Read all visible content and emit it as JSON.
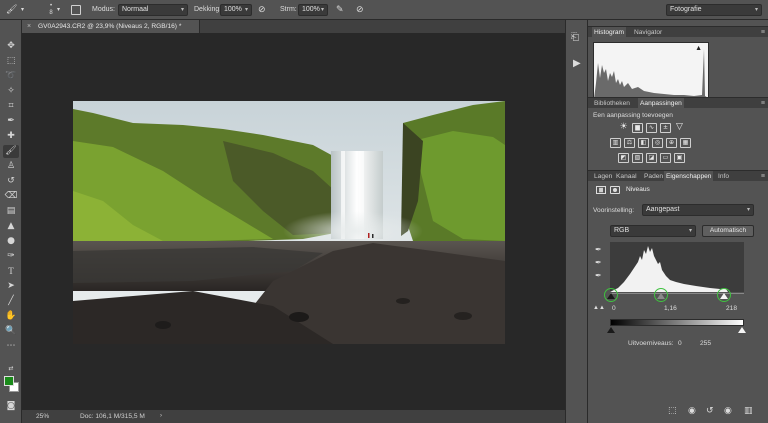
{
  "optionsBar": {
    "brushSize": "8",
    "modusLabel": "Modus:",
    "modusValue": "Normaal",
    "dekkingLabel": "Dekking:",
    "dekkingValue": "100%",
    "stroomLabel": "Strm:",
    "stroomValue": "100%",
    "workspace": "Fotografie"
  },
  "document": {
    "tabTitle": "GV0A2943.CR2 @ 23,9% (Niveaus 2, RGB/16) *",
    "zoom": "25%",
    "docInfo": "Doc: 106,1 M/315,5 M"
  },
  "colors": {
    "foreground": "#1a8a1a",
    "background": "#ffffff",
    "highlight": "#3fc23f"
  },
  "histogramPanel": {
    "tabs": [
      "Histogram",
      "Navigator"
    ]
  },
  "adjustmentsPanel": {
    "tabs": [
      "Bibliotheken",
      "Aanpassingen"
    ],
    "addLabel": "Een aanpassing toevoegen"
  },
  "propertiesPanel": {
    "tabs": [
      "Lagen",
      "Kanaal",
      "Paden",
      "Eigenschappen",
      "Info"
    ],
    "title": "Niveaus",
    "presetLabel": "Voorinstelling:",
    "presetValue": "Aangepast",
    "channel": "RGB",
    "autoButton": "Automatisch",
    "inputLevels": {
      "black": "0",
      "gamma": "1,16",
      "white": "218"
    },
    "outputLabel": "Uitvoerniveaus:",
    "outputLevels": {
      "black": "0",
      "white": "255"
    }
  }
}
